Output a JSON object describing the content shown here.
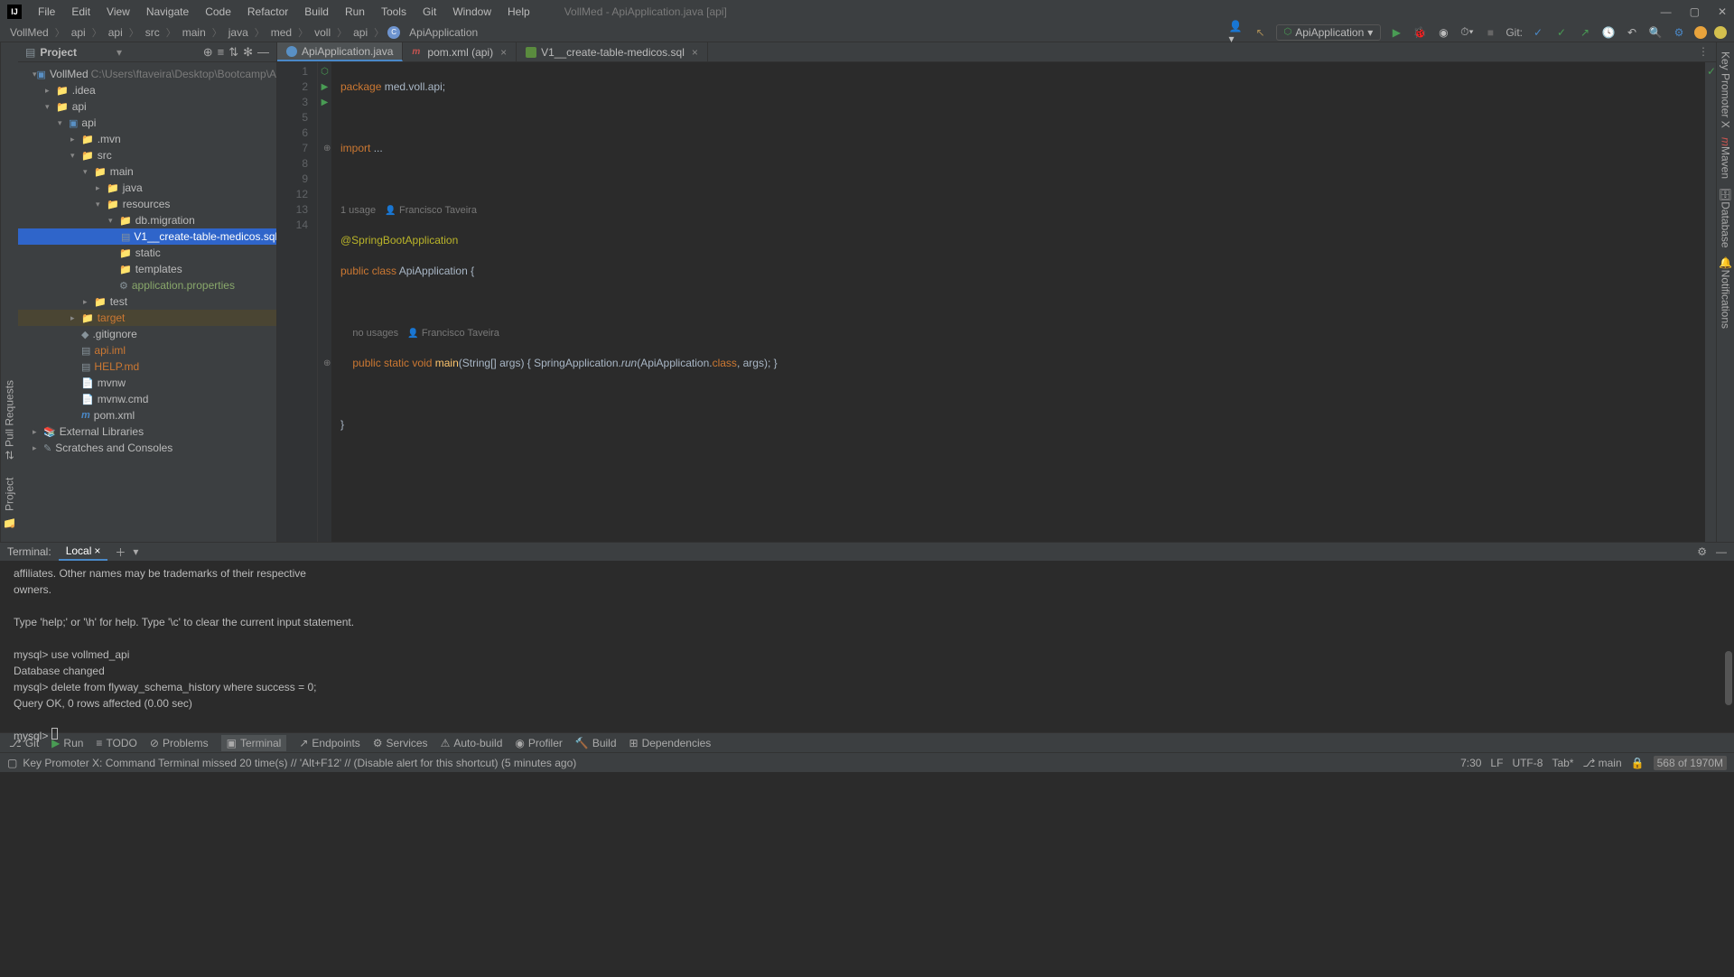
{
  "titleBar": {
    "menus": [
      "File",
      "Edit",
      "View",
      "Navigate",
      "Code",
      "Refactor",
      "Build",
      "Run",
      "Tools",
      "Git",
      "Window",
      "Help"
    ],
    "projectTitle": "VollMed - ApiApplication.java [api]"
  },
  "breadcrumbs": [
    "VollMed",
    "api",
    "api",
    "src",
    "main",
    "java",
    "med",
    "voll",
    "api",
    "ApiApplication"
  ],
  "runConfig": "ApiApplication",
  "gitLabel": "Git:",
  "projectPanel": {
    "title": "Project",
    "tree": [
      {
        "indent": 0,
        "arrow": "▾",
        "icon": "module",
        "label": "VollMed",
        "suffix": "C:\\Users\\ftaveira\\Desktop\\Bootcamp\\Alura\\Projetos\\V"
      },
      {
        "indent": 1,
        "arrow": "▸",
        "icon": "folder",
        "label": ".idea"
      },
      {
        "indent": 1,
        "arrow": "▾",
        "icon": "folder",
        "label": "api"
      },
      {
        "indent": 2,
        "arrow": "▾",
        "icon": "module",
        "label": "api"
      },
      {
        "indent": 3,
        "arrow": "▸",
        "icon": "folder",
        "label": ".mvn"
      },
      {
        "indent": 3,
        "arrow": "▾",
        "icon": "source",
        "label": "src"
      },
      {
        "indent": 4,
        "arrow": "▾",
        "icon": "source",
        "label": "main"
      },
      {
        "indent": 5,
        "arrow": "▸",
        "icon": "source",
        "label": "java"
      },
      {
        "indent": 5,
        "arrow": "▾",
        "icon": "resource",
        "label": "resources"
      },
      {
        "indent": 6,
        "arrow": "▾",
        "icon": "folder",
        "label": "db.migration"
      },
      {
        "indent": 7,
        "arrow": "",
        "icon": "sql",
        "label": "V1__create-table-medicos.sql",
        "selected": true
      },
      {
        "indent": 6,
        "arrow": "",
        "icon": "folder",
        "label": "static"
      },
      {
        "indent": 6,
        "arrow": "",
        "icon": "folder",
        "label": "templates"
      },
      {
        "indent": 6,
        "arrow": "",
        "icon": "prop",
        "label": "application.properties",
        "green": true
      },
      {
        "indent": 4,
        "arrow": "▸",
        "icon": "test",
        "label": "test"
      },
      {
        "indent": 3,
        "arrow": "▸",
        "icon": "target",
        "label": "target",
        "orange": true,
        "highlightTarget": true
      },
      {
        "indent": 3,
        "arrow": "",
        "icon": "git",
        "label": ".gitignore"
      },
      {
        "indent": 3,
        "arrow": "",
        "icon": "iml",
        "label": "api.iml",
        "orange": true
      },
      {
        "indent": 3,
        "arrow": "",
        "icon": "md",
        "label": "HELP.md",
        "orange": true
      },
      {
        "indent": 3,
        "arrow": "",
        "icon": "file",
        "label": "mvnw"
      },
      {
        "indent": 3,
        "arrow": "",
        "icon": "file",
        "label": "mvnw.cmd"
      },
      {
        "indent": 3,
        "arrow": "",
        "icon": "maven",
        "label": "pom.xml"
      },
      {
        "indent": 0,
        "arrow": "▸",
        "icon": "lib",
        "label": "External Libraries"
      },
      {
        "indent": 0,
        "arrow": "▸",
        "icon": "scratch",
        "label": "Scratches and Consoles"
      }
    ]
  },
  "editorTabs": [
    {
      "icon": "java",
      "label": "ApiApplication.java",
      "active": true
    },
    {
      "icon": "maven",
      "label": "pom.xml (api)"
    },
    {
      "icon": "sql",
      "label": "V1__create-table-medicos.sql"
    }
  ],
  "code": {
    "lines": [
      1,
      2,
      3,
      5,
      6,
      7,
      8,
      9,
      12,
      13,
      14
    ],
    "usage1": "1 usage",
    "author": "Francisco Taveira",
    "noUsages": "no usages",
    "line1_pkg": "package ",
    "line1_id": "med.voll.api",
    "line3_import": "import ",
    "line3_dots": "...",
    "line6_ann": "@SpringBootApplication",
    "line7_pub": "public ",
    "line7_cls": "class ",
    "line7_name": "ApiApplication ",
    "line7_brace": "{",
    "line9_pub": "public ",
    "line9_stat": "static ",
    "line9_void": "void ",
    "line9_main": "main",
    "line9_p1": "(String[] args) ",
    "line9_b1": "{ ",
    "line9_sa": "SpringApplication.",
    "line9_run": "run",
    "line9_p2": "(ApiApplication.",
    "line9_class": "class",
    "line9_p3": ", args); ",
    "line9_b2": "}",
    "line13_brace": "}"
  },
  "terminal": {
    "titleLabel": "Terminal:",
    "tabLabel": "Local",
    "content": "affiliates. Other names may be trademarks of their respective\nowners.\n\nType 'help;' or '\\h' for help. Type '\\c' to clear the current input statement.\n\nmysql> use vollmed_api\nDatabase changed\nmysql> delete from flyway_schema_history where success = 0;\nQuery OK, 0 rows affected (0.00 sec)\n\nmysql> "
  },
  "toolWindows": [
    "Git",
    "Run",
    "TODO",
    "Problems",
    "Terminal",
    "Endpoints",
    "Services",
    "Auto-build",
    "Profiler",
    "Build",
    "Dependencies"
  ],
  "statusBar": {
    "message": "Key Promoter X: Command Terminal missed 20 time(s) // 'Alt+F12' // (Disable alert for this shortcut) (5 minutes ago)",
    "pos": "7:30",
    "lf": "LF",
    "enc": "UTF-8",
    "indent": "Tab*",
    "branch": "main",
    "mem": "568 of 1970M"
  },
  "leftGutterTabs": [
    "Project",
    "Pull Requests"
  ],
  "rightGutterTabs": [
    "Key Promoter X",
    "Maven",
    "Database",
    "Notifications"
  ]
}
